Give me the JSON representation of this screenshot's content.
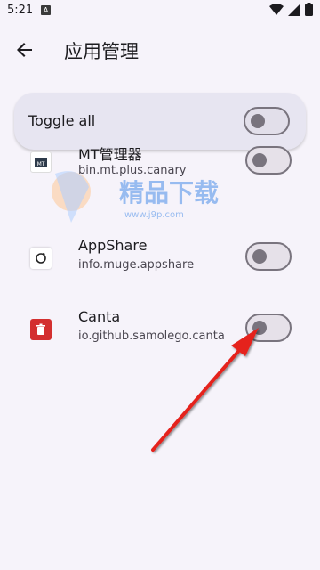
{
  "status_bar": {
    "time": "5:21",
    "notification_glyph": "A",
    "icons": [
      "wifi-icon",
      "signal-icon",
      "battery-icon"
    ]
  },
  "header": {
    "title": "应用管理",
    "back_icon": "arrow-back-icon"
  },
  "toggle_all": {
    "label": "Toggle all",
    "enabled": false
  },
  "apps": [
    {
      "name": "MT管理器",
      "package": "bin.mt.plus.canary",
      "enabled": false,
      "icon": "mt-manager-icon"
    },
    {
      "name": "AppShare",
      "package": "info.muge.appshare",
      "enabled": false,
      "icon": "appshare-icon"
    },
    {
      "name": "Canta",
      "package": "io.github.samolego.canta",
      "enabled": false,
      "icon": "canta-trash-icon"
    }
  ],
  "watermark": {
    "text": "精品下载",
    "url": "www.j9p.com"
  },
  "colors": {
    "background": "#F6F3FA",
    "card": "#E7E5F1",
    "switch_outline": "#79747E",
    "annotation_arrow": "#E5201E",
    "canta_icon": "#D32F2F"
  }
}
